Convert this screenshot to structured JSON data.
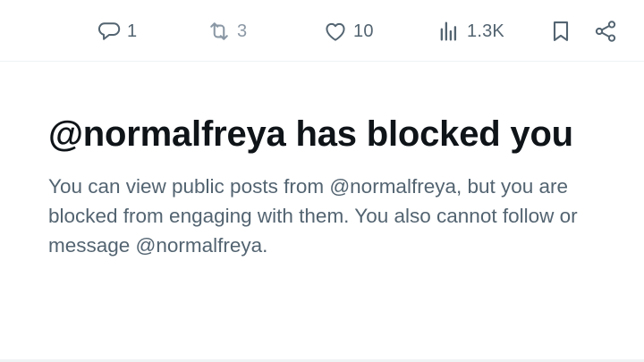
{
  "actions": {
    "reply": {
      "icon": "reply-icon",
      "count": "1"
    },
    "retweet": {
      "icon": "retweet-icon",
      "count": "3"
    },
    "like": {
      "icon": "heart-icon",
      "count": "10"
    },
    "views": {
      "icon": "views-icon",
      "count": "1.3K"
    },
    "bookmark": {
      "icon": "bookmark-icon"
    },
    "share": {
      "icon": "share-icon"
    }
  },
  "blocked": {
    "title": "@normalfreya has blocked you",
    "description": "You can view public posts from @normalfreya, but you are blocked from engaging with them. You also cannot follow or message @normalfreya."
  },
  "colors": {
    "text_primary": "#0f1419",
    "text_secondary": "#536471",
    "divider": "#eff3f4"
  }
}
